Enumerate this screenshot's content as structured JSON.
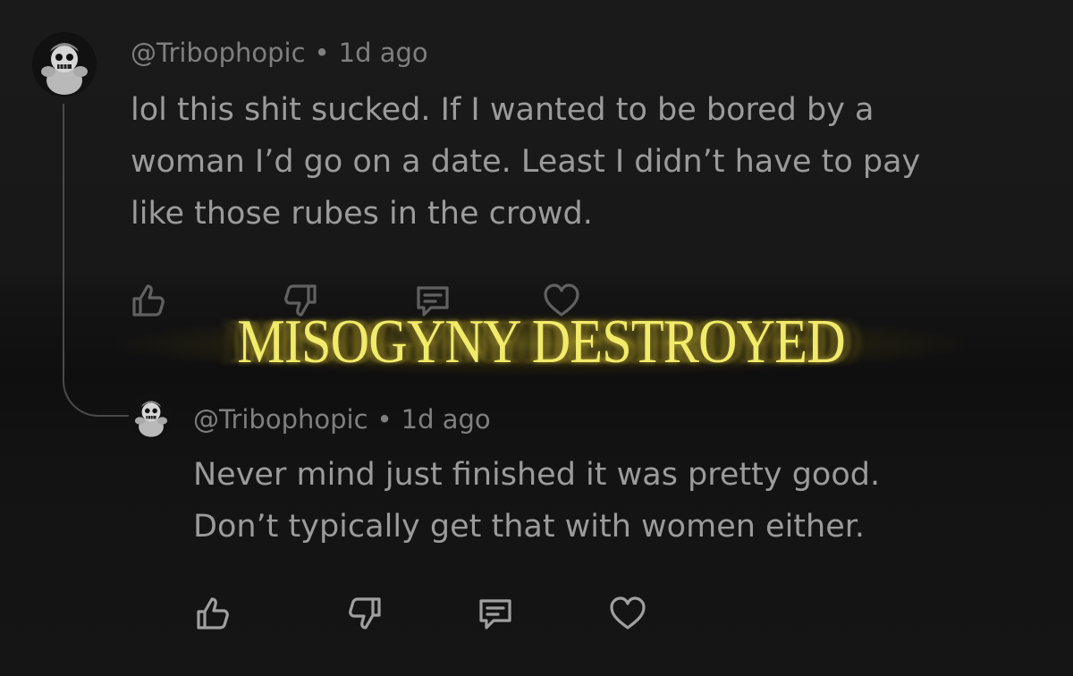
{
  "comments": [
    {
      "username": "@Tribophopic",
      "separator": "•",
      "timestamp": "1d ago",
      "lines": [
        "lol this shit sucked. If I wanted to be bored by a",
        "woman I’d go on a date. Least I didn’t have to pay",
        "like those rubes in the crowd."
      ],
      "avatar_icon": "skull-plush-avatar",
      "actions": [
        "thumbs-up-icon",
        "thumbs-down-icon",
        "reply-icon",
        "heart-icon"
      ]
    },
    {
      "username": "@Tribophopic",
      "separator": "•",
      "timestamp": "1d ago",
      "lines": [
        "Never mind just finished it was pretty good.",
        "Don’t typically get that with women either."
      ],
      "avatar_icon": "skull-plush-avatar",
      "actions": [
        "thumbs-up-icon",
        "thumbs-down-icon",
        "reply-icon",
        "heart-icon"
      ]
    }
  ],
  "banner": {
    "text": "MISOGYNY DESTROYED",
    "color": "#f2ea6a"
  },
  "colors": {
    "background": "#161616",
    "text": "#9b9b9b",
    "meta": "#7f7f7f",
    "icon": "#a0a0a0"
  }
}
